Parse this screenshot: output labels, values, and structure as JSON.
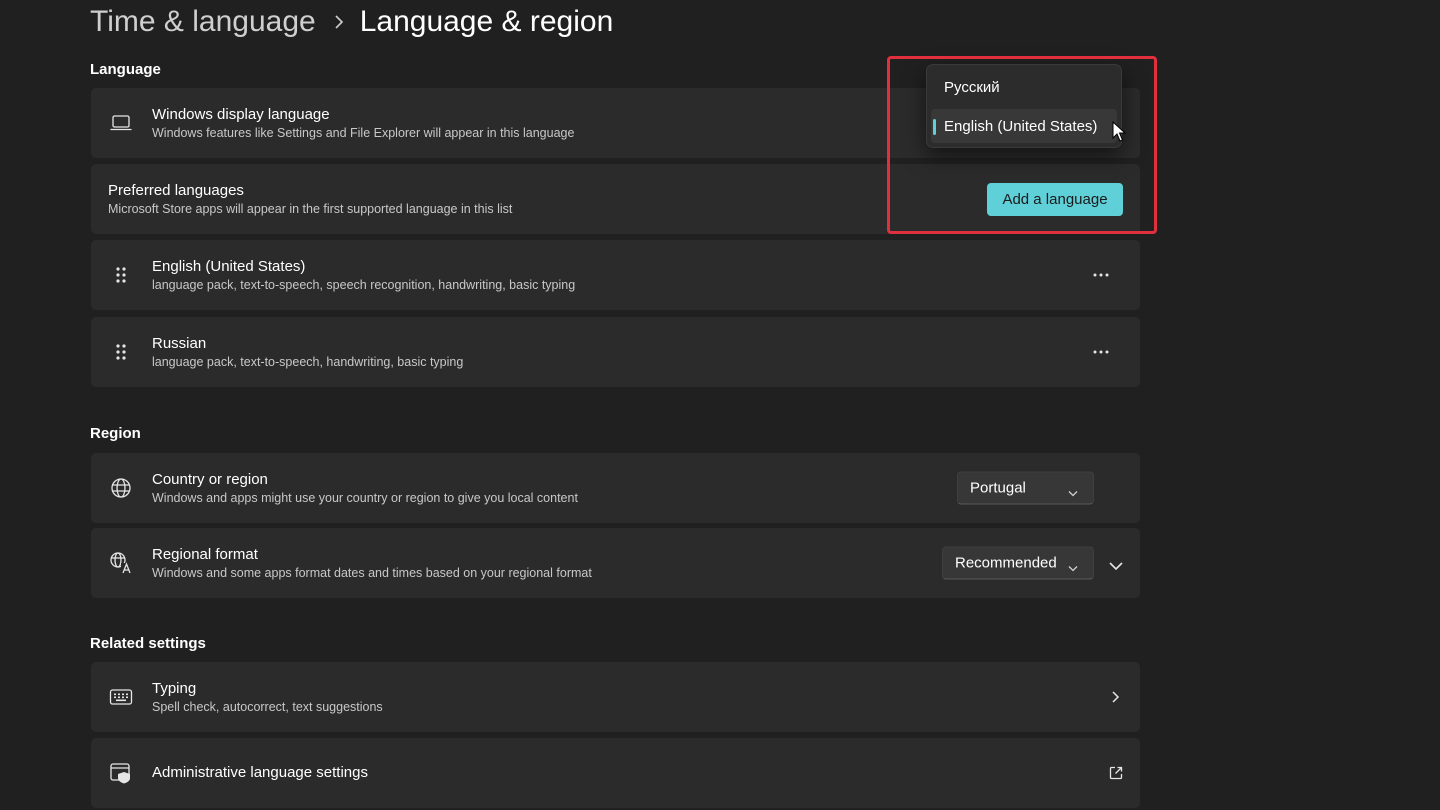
{
  "breadcrumb": {
    "parent": "Time & language",
    "current": "Language & region"
  },
  "language_section": {
    "title": "Language",
    "display_language": {
      "title": "Windows display language",
      "description": "Windows features like Settings and File Explorer will appear in this language",
      "icon": "laptop-icon",
      "options": [
        "Русский",
        "English (United States)"
      ],
      "selected": "English (United States)"
    },
    "preferred": {
      "title": "Preferred languages",
      "description": "Microsoft Store apps will appear in the first supported language in this list",
      "add_button": "Add a language"
    },
    "languages": [
      {
        "name": "English (United States)",
        "features": "language pack, text-to-speech, speech recognition, handwriting, basic typing"
      },
      {
        "name": "Russian",
        "features": "language pack, text-to-speech, handwriting, basic typing"
      }
    ]
  },
  "region_section": {
    "title": "Region",
    "country": {
      "title": "Country or region",
      "description": "Windows and apps might use your country or region to give you local content",
      "value": "Portugal",
      "icon": "globe-icon"
    },
    "format": {
      "title": "Regional format",
      "description": "Windows and some apps format dates and times based on your regional format",
      "value": "Recommended",
      "icon": "regional-format-icon"
    }
  },
  "related_section": {
    "title": "Related settings",
    "typing": {
      "title": "Typing",
      "description": "Spell check, autocorrect, text suggestions",
      "icon": "keyboard-icon"
    },
    "admin": {
      "title": "Administrative language settings",
      "icon": "admin-shield-icon"
    }
  },
  "colors": {
    "background": "#202020",
    "card": "#2b2b2b",
    "accent": "#5fcfd8",
    "highlight": "#e0303e"
  }
}
